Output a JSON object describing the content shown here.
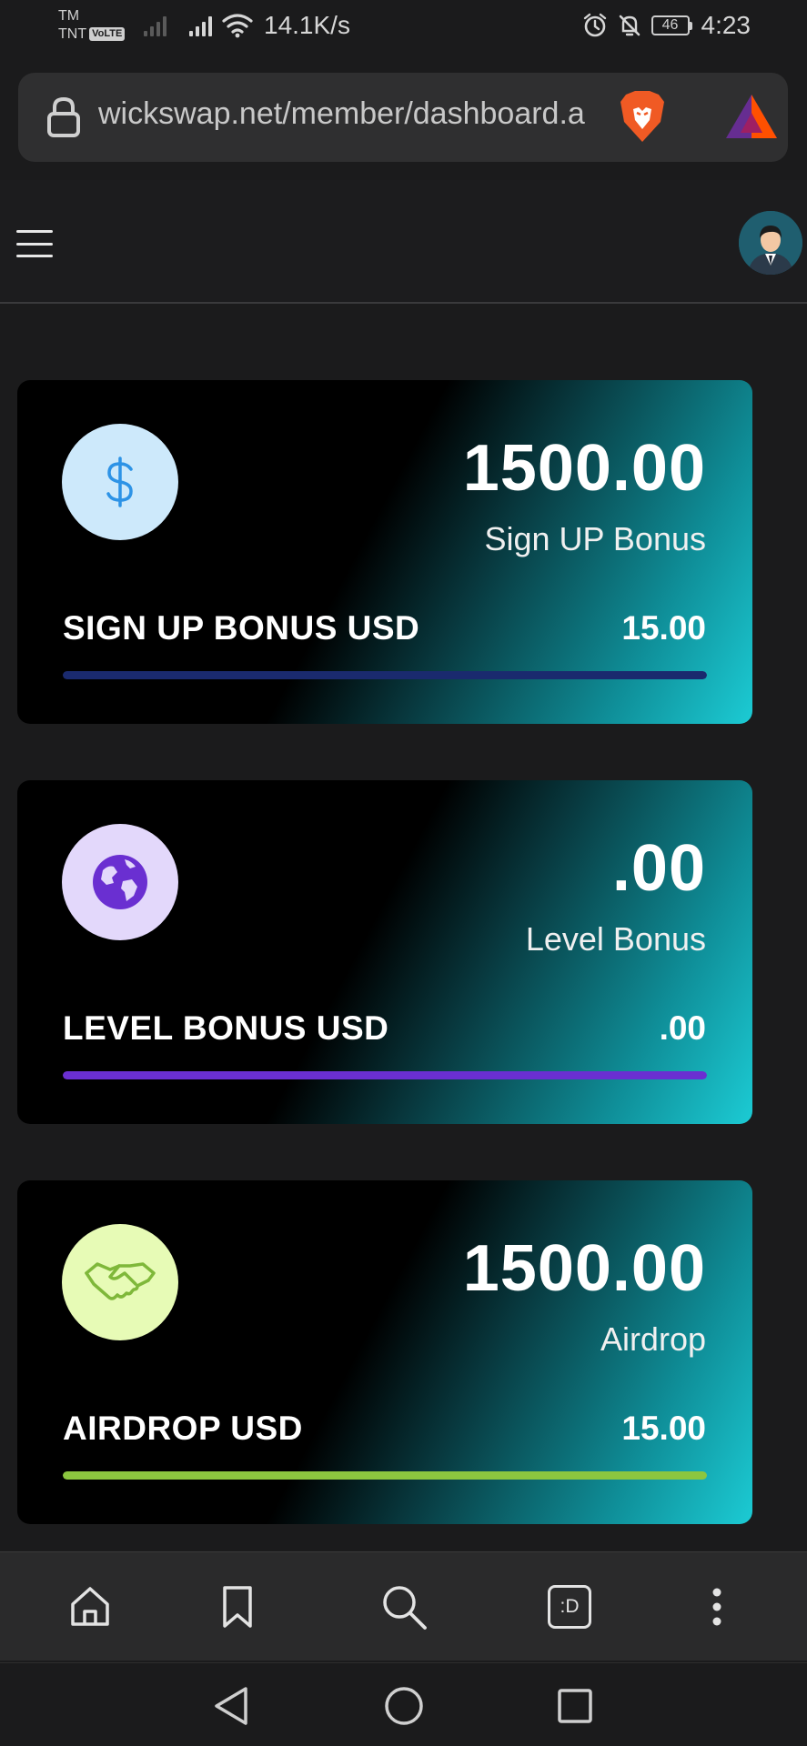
{
  "status_bar": {
    "carrier_top": "TM",
    "carrier_bottom": "TNT",
    "volte": "VoLTE",
    "net_speed": "14.1K/s",
    "battery": "46",
    "time": "4:23",
    "icons": [
      "signal-icon",
      "wifi-icon",
      "alarm-icon",
      "mute-icon",
      "battery-icon"
    ]
  },
  "browser": {
    "url": "wickswap.net/member/dashboard.a",
    "icons": [
      "lock-icon",
      "brave-shield-icon",
      "bat-rewards-icon"
    ]
  },
  "header": {
    "icons": [
      "hamburger-menu-icon",
      "user-avatar"
    ]
  },
  "cards": [
    {
      "amount": "1500.00",
      "subtitle": "Sign UP Bonus",
      "label": "SIGN UP BONUS USD",
      "value": "15.00",
      "icon": "dollar-icon",
      "icon_bg": "#cde9fb",
      "icon_color": "#2d93e6",
      "bar_color": "#1a2a6e",
      "progress": 1.0
    },
    {
      "amount": ".00",
      "subtitle": "Level Bonus",
      "label": "LEVEL BONUS USD",
      "value": ".00",
      "icon": "globe-icon",
      "icon_bg": "#e3d8fb",
      "icon_color": "#6a2fd1",
      "bar_color": "#6a2fd1",
      "progress": 1.0
    },
    {
      "amount": "1500.00",
      "subtitle": "Airdrop",
      "label": "AIRDROP USD",
      "value": "15.00",
      "icon": "handshake-icon",
      "icon_bg": "#e7fbb6",
      "icon_color": "#7fb83a",
      "bar_color": "#8cc63f",
      "progress": 1.0
    }
  ],
  "bottom_toolbar": {
    "tab_count": ":D",
    "icons": [
      "home-icon",
      "bookmark-icon",
      "search-icon",
      "tabs-icon",
      "more-icon"
    ]
  },
  "android_nav": {
    "icons": [
      "back-icon",
      "home-circle-icon",
      "recents-icon"
    ]
  }
}
